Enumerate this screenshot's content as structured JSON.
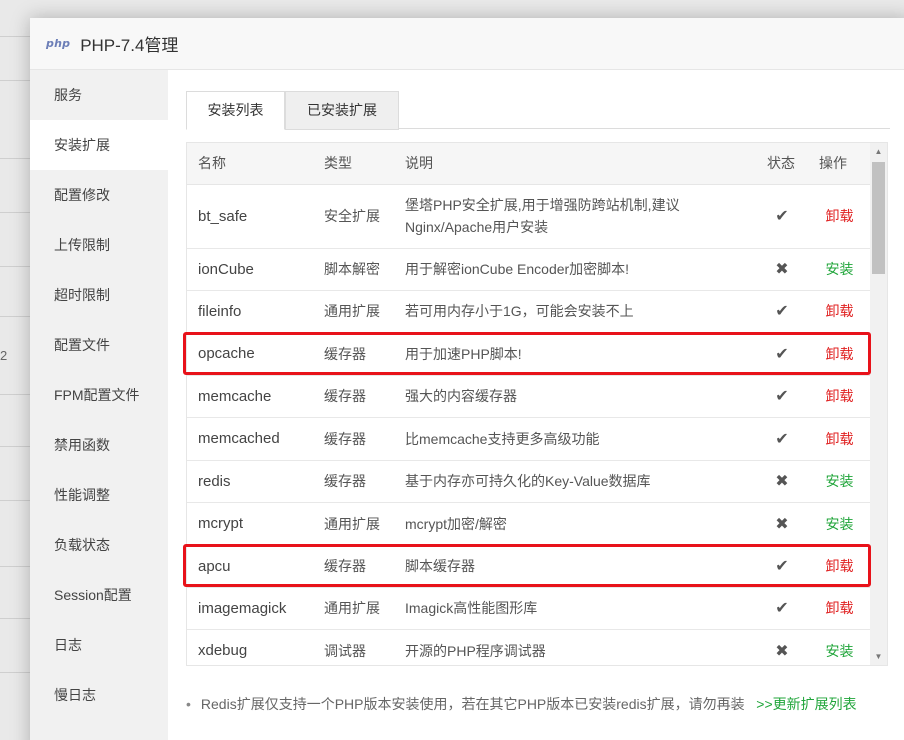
{
  "background": {
    "fragment": "2"
  },
  "modal": {
    "logo": "php",
    "title": "PHP-7.4管理"
  },
  "sidebar": {
    "items": [
      {
        "label": "服务"
      },
      {
        "label": "安装扩展"
      },
      {
        "label": "配置修改"
      },
      {
        "label": "上传限制"
      },
      {
        "label": "超时限制"
      },
      {
        "label": "配置文件"
      },
      {
        "label": "FPM配置文件"
      },
      {
        "label": "禁用函数"
      },
      {
        "label": "性能调整"
      },
      {
        "label": "负载状态"
      },
      {
        "label": "Session配置"
      },
      {
        "label": "日志"
      },
      {
        "label": "慢日志"
      }
    ],
    "active_index": 1
  },
  "tabs": [
    {
      "label": "安装列表",
      "active": true
    },
    {
      "label": "已安装扩展",
      "active": false
    }
  ],
  "table": {
    "headers": {
      "name": "名称",
      "type": "类型",
      "desc": "说明",
      "status": "状态",
      "op": "操作"
    },
    "rows": [
      {
        "name": "bt_safe",
        "type": "安全扩展",
        "desc": "堡塔PHP安全扩展,用于增强防跨站机制,建议Nginx/Apache用户安装",
        "status": "✔",
        "op": "卸载",
        "installed": true
      },
      {
        "name": "ionCube",
        "type": "脚本解密",
        "desc": "用于解密ionCube Encoder加密脚本!",
        "status": "✖",
        "op": "安装",
        "installed": false
      },
      {
        "name": "fileinfo",
        "type": "通用扩展",
        "desc": "若可用内存小于1G，可能会安装不上",
        "status": "✔",
        "op": "卸载",
        "installed": true
      },
      {
        "name": "opcache",
        "type": "缓存器",
        "desc": "用于加速PHP脚本!",
        "status": "✔",
        "op": "卸载",
        "installed": true,
        "highlighted": true
      },
      {
        "name": "memcache",
        "type": "缓存器",
        "desc": "强大的内容缓存器",
        "status": "✔",
        "op": "卸载",
        "installed": true
      },
      {
        "name": "memcached",
        "type": "缓存器",
        "desc": "比memcache支持更多高级功能",
        "status": "✔",
        "op": "卸载",
        "installed": true
      },
      {
        "name": "redis",
        "type": "缓存器",
        "desc": "基于内存亦可持久化的Key-Value数据库",
        "status": "✖",
        "op": "安装",
        "installed": false
      },
      {
        "name": "mcrypt",
        "type": "通用扩展",
        "desc": "mcrypt加密/解密",
        "status": "✖",
        "op": "安装",
        "installed": false
      },
      {
        "name": "apcu",
        "type": "缓存器",
        "desc": "脚本缓存器",
        "status": "✔",
        "op": "卸载",
        "installed": true,
        "highlighted": true
      },
      {
        "name": "imagemagick",
        "type": "通用扩展",
        "desc": "Imagick高性能图形库",
        "status": "✔",
        "op": "卸载",
        "installed": true
      },
      {
        "name": "xdebug",
        "type": "调试器",
        "desc": "开源的PHP程序调试器",
        "status": "✖",
        "op": "安装",
        "installed": false
      }
    ]
  },
  "notice": {
    "text": "Redis扩展仅支持一个PHP版本安装使用，若在其它PHP版本已安装redis扩展，请勿再装",
    "link": ">>更新扩展列表"
  },
  "colors": {
    "uninstall": "#e02020",
    "install": "#20a53a",
    "highlight": "#e8121a"
  }
}
